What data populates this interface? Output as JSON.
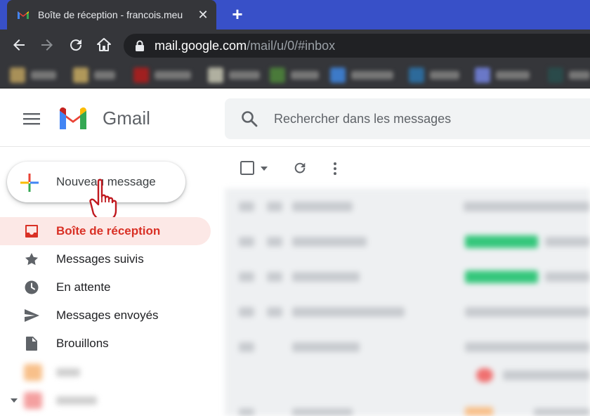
{
  "browser": {
    "tab_title": "Boîte de réception - francois.meu",
    "close_glyph": "✕",
    "new_tab_glyph": "+",
    "url_host": "mail.google.com",
    "url_path": "/mail/u/0/#inbox"
  },
  "gmail": {
    "brand": "Gmail",
    "search_placeholder": "Rechercher dans les messages",
    "compose_label": "Nouveau message",
    "nav": [
      {
        "label": "Boîte de réception",
        "icon": "inbox-icon",
        "active": true
      },
      {
        "label": "Messages suivis",
        "icon": "star-icon",
        "active": false
      },
      {
        "label": "En attente",
        "icon": "clock-icon",
        "active": false
      },
      {
        "label": "Messages envoyés",
        "icon": "send-icon",
        "active": false
      },
      {
        "label": "Brouillons",
        "icon": "draft-icon",
        "active": false
      }
    ]
  },
  "colors": {
    "tabstrip": "#3850c8",
    "chrome_dark": "#35363a",
    "active_red": "#d93025",
    "active_bg": "#fce8e6",
    "label_green": "#34c77b"
  }
}
